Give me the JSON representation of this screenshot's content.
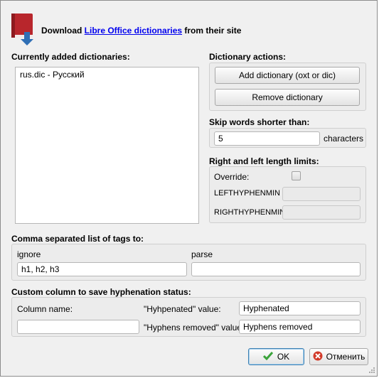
{
  "header": {
    "text_before": "Download ",
    "link_text": "Libre Office dictionaries",
    "text_after": " from their site"
  },
  "dictionaries": {
    "heading": "Currently added dictionaries:",
    "items": [
      "rus.dic - Русский"
    ]
  },
  "actions": {
    "heading": "Dictionary actions:",
    "add_label": "Add dictionary (oxt or dic)",
    "remove_label": "Remove dictionary"
  },
  "skip": {
    "heading": "Skip words shorter than:",
    "value": "5",
    "unit": "characters"
  },
  "limits": {
    "heading": "Right and left length limits:",
    "override_label": "Override:",
    "override_checked": false,
    "left_label": "LEFTHYPHENMIN",
    "left_value": "",
    "right_label": "RIGHTHYPHENMIN",
    "right_value": ""
  },
  "tags": {
    "heading": "Comma separated list of tags to:",
    "ignore_label": "ignore",
    "ignore_value": "h1, h2, h3",
    "parse_label": "parse",
    "parse_value": ""
  },
  "custom_column": {
    "heading": "Custom column to save hyphenation status:",
    "column_name_label": "Column name:",
    "column_name_value": "",
    "hyphenated_label": "\"Hyhpenated\" value:",
    "hyphenated_value": "Hyphenated",
    "removed_label": "\"Hyphens removed\" value:",
    "removed_value": "Hyphens removed"
  },
  "footer": {
    "ok_label": "OK",
    "cancel_label": "Отменить"
  },
  "colors": {
    "link": "#0000ee",
    "ok_icon": "#3aa33a",
    "cancel_icon": "#d23a2a",
    "book": "#b8262c",
    "arrow": "#2f6fb5"
  }
}
